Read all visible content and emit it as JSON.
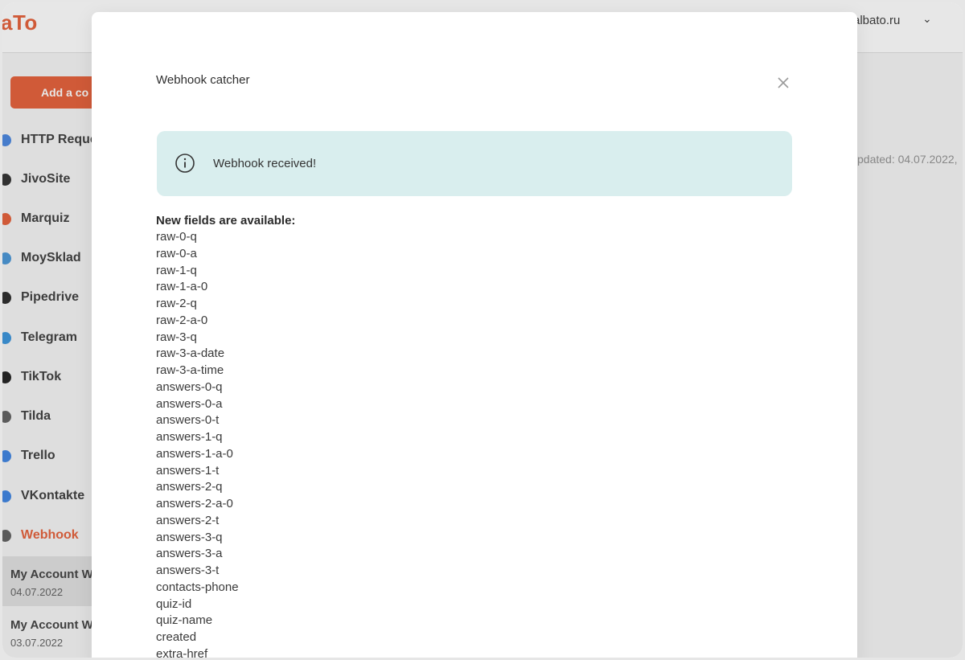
{
  "header": {
    "logo_text": "aTo",
    "account_email": "albato.ru"
  },
  "sidebar": {
    "add_button_label": "Add a co",
    "services": [
      {
        "label": "HTTP Reque",
        "icon": "http-icon",
        "color": "#3b7ddd"
      },
      {
        "label": "JivoSite",
        "icon": "jivosite-icon",
        "color": "#222222"
      },
      {
        "label": "Marquiz",
        "icon": "marquiz-icon",
        "color": "#e3542a"
      },
      {
        "label": "MoySklad",
        "icon": "moysklad-icon",
        "color": "#3b8ed4"
      },
      {
        "label": "Pipedrive",
        "icon": "pipedrive-icon",
        "color": "#1a1a1a"
      },
      {
        "label": "Telegram",
        "icon": "telegram-icon",
        "color": "#2a8bd8"
      },
      {
        "label": "TikTok",
        "icon": "tiktok-icon",
        "color": "#111111"
      },
      {
        "label": "Tilda",
        "icon": "tilda-icon",
        "color": "#555555"
      },
      {
        "label": "Trello",
        "icon": "trello-icon",
        "color": "#2f7be0"
      },
      {
        "label": "VKontakte",
        "icon": "vk-icon",
        "color": "#2f7be0"
      },
      {
        "label": "Webhook",
        "icon": "webhook-icon",
        "color": "#555555"
      }
    ],
    "accounts": [
      {
        "name": "My Account W",
        "date": "04.07.2022"
      },
      {
        "name": "My Account W",
        "date": "03.07.2022"
      }
    ]
  },
  "main": {
    "updated_text": "pdated: 04.07.2022,"
  },
  "modal": {
    "title": "Webhook catcher",
    "alert_message": "Webhook received!",
    "fields_title": "New fields are available:",
    "fields": [
      "raw-0-q",
      "raw-0-a",
      "raw-1-q",
      "raw-1-a-0",
      "raw-2-q",
      "raw-2-a-0",
      "raw-3-q",
      "raw-3-a-date",
      "raw-3-a-time",
      "answers-0-q",
      "answers-0-a",
      "answers-0-t",
      "answers-1-q",
      "answers-1-a-0",
      "answers-1-t",
      "answers-2-q",
      "answers-2-a-0",
      "answers-2-t",
      "answers-3-q",
      "answers-3-a",
      "answers-3-t",
      "contacts-phone",
      "quiz-id",
      "quiz-name",
      "created",
      "extra-href"
    ]
  },
  "colors": {
    "brand": "#e3542a",
    "alert_bg": "#d9eeee",
    "active_service": "#e3542a"
  }
}
